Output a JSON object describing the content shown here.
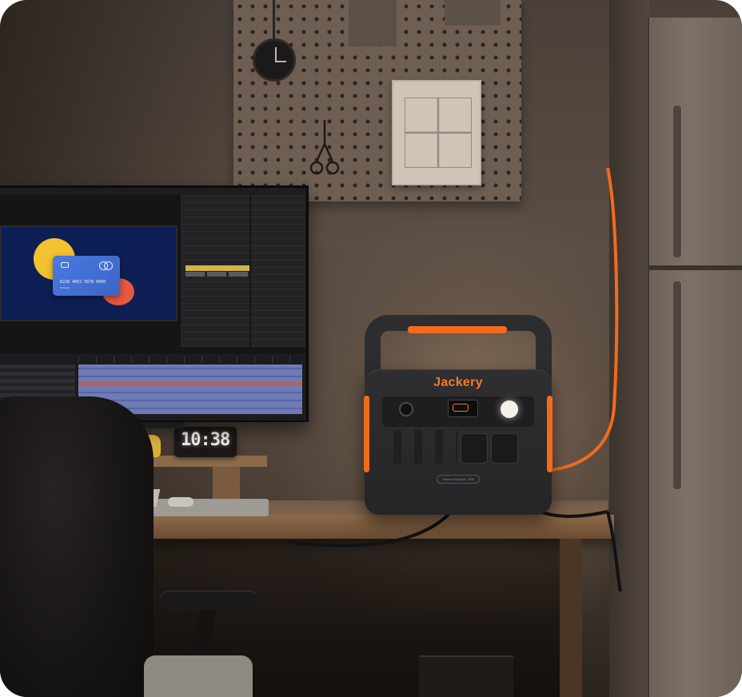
{
  "brand": {
    "name": "Jackery",
    "accent": "#f26b1d",
    "model_label": "Jackery Explorer 1000"
  },
  "alarm_clock": {
    "time": "10:38"
  },
  "monitor": {
    "card": {
      "number": "6228 4852 5678 0000",
      "holder": "Mr.Name",
      "colors": {
        "card": "#3d64c6",
        "circle_yellow": "#f2c230",
        "circle_red": "#e6583f",
        "viewer_bg": "#0d1f55"
      }
    }
  },
  "icons": {
    "power": "power-button-icon",
    "screen": "display-screen-icon",
    "light": "led-light-icon",
    "outlet": "ac-outlet-icon",
    "clock": "wall-clock-icon"
  }
}
